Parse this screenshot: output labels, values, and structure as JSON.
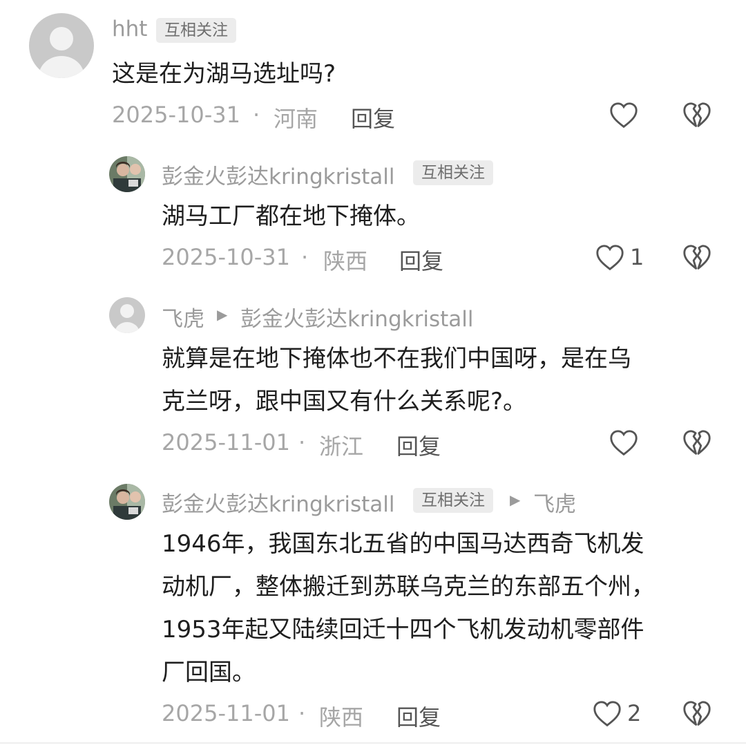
{
  "comments": [
    {
      "username": "hht",
      "tag": "互相关注",
      "content": "这是在为湖马选址吗?",
      "date": "2025-10-31",
      "location": "河南",
      "reply_label": "回复",
      "likes": ""
    },
    {
      "username": "彭金火彭达kringkristall",
      "tag": "互相关注",
      "content": "湖马工厂都在地下掩体。",
      "date": "2025-10-31",
      "location": "陕西",
      "reply_label": "回复",
      "likes": "1"
    },
    {
      "username": "飞虎",
      "reply_to": "彭金火彭达kringkristall",
      "content_lines": [
        "就算是在地下掩体也不在我们中国呀，是在乌",
        "克兰呀，跟中国又有什么关系呢?。"
      ],
      "date": "2025-11-01",
      "location": "浙江",
      "reply_label": "回复",
      "likes": ""
    },
    {
      "username": "彭金火彭达kringkristall",
      "tag": "互相关注",
      "reply_to": "飞虎",
      "content_lines": [
        "1946年，我国东北五省的中国马达西奇飞机发",
        "动机厂，整体搬迁到苏联乌克兰的东部五个州，",
        "1953年起又陆续回迁十四个飞机发动机零部件",
        "厂回国。"
      ],
      "date": "2025-11-01",
      "location": "陕西",
      "reply_label": "回复",
      "likes": "2"
    }
  ],
  "separator": "·",
  "icons": {
    "like": "heart-outline-icon",
    "dislike": "broken-heart-icon",
    "reply_arrow": "play-arrow-icon"
  },
  "colors": {
    "meta_text": "#a6a6a6",
    "username_text": "#9b9b9b",
    "tag_bg": "#ececec"
  }
}
